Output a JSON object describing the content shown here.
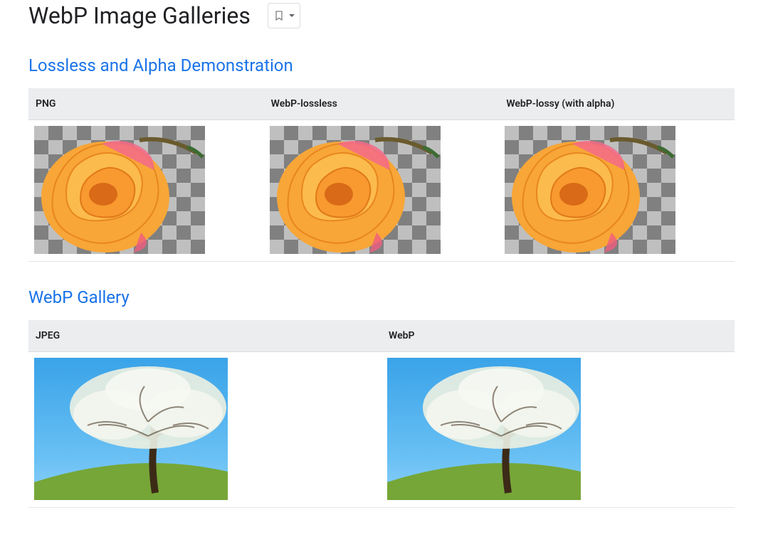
{
  "page_title": "WebP Image Galleries",
  "bookmark_button": {
    "label": "Bookmark"
  },
  "sections": {
    "lossless": {
      "heading": "Lossless and Alpha Demonstration",
      "columns": [
        "PNG",
        "WebP-lossless",
        "WebP-lossy (with alpha)"
      ],
      "image_description": "Orange rose with transparent (checkerboard) background"
    },
    "gallery": {
      "heading": "WebP Gallery",
      "columns": [
        "JPEG",
        "WebP"
      ],
      "image_description": "Blossoming tree on a grassy hill against a blue sky"
    }
  }
}
